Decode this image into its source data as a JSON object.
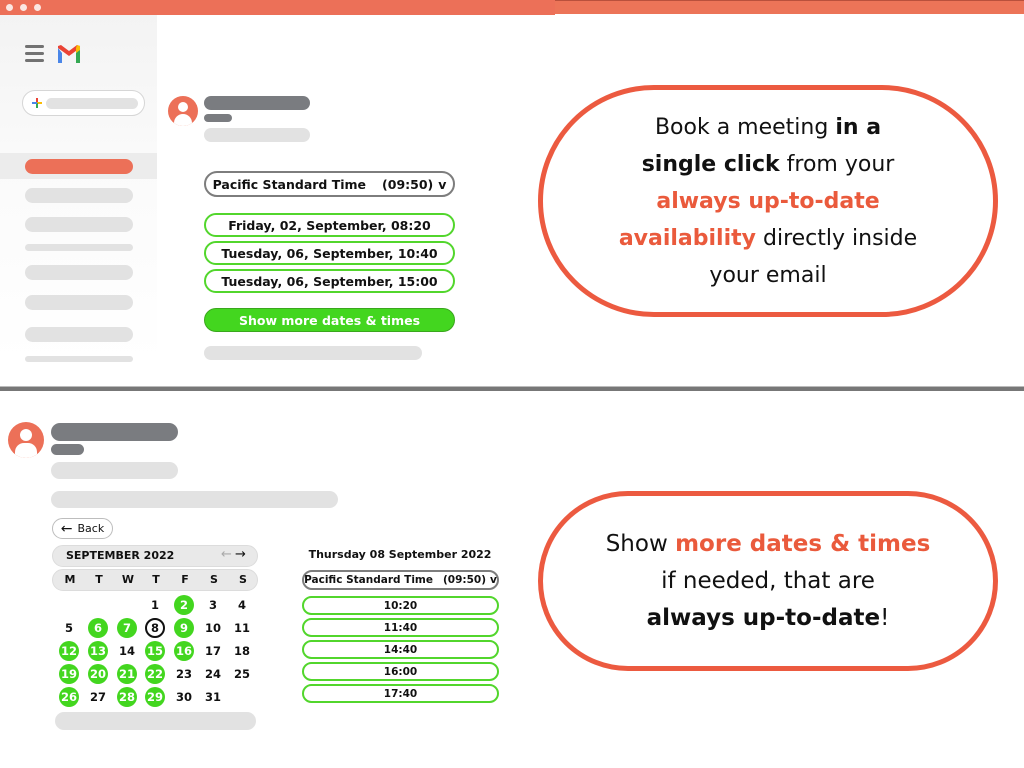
{
  "window": {
    "controls": [
      "close-dot",
      "minimize-dot",
      "maximize-dot"
    ],
    "accent_color": "#ec7058"
  },
  "gmail": {
    "menu_icon": "hamburger-icon",
    "logo_icon": "gmail-logo-icon",
    "compose_icon": "plus-icon"
  },
  "top_panel": {
    "timezone_select": {
      "label": "Pacific Standard Time",
      "current_time": "(09:50)",
      "chevron": "v"
    },
    "suggested_slots": [
      "Friday, 02, September, 08:20",
      "Tuesday, 06, September, 10:40",
      "Tuesday, 06, September, 15:00"
    ],
    "show_more_label": "Show more dates & times",
    "callout": {
      "line1_plain": "Book a meeting ",
      "line1_bold": "in a",
      "line2_bold": "single click",
      "line2_plain": " from your",
      "line3_accent": "always up-to-date",
      "line4_accent": "availability",
      "line4_plain": " directly inside",
      "line5_plain": "your email"
    }
  },
  "bottom_panel": {
    "back_label": "Back",
    "calendar": {
      "month_label": "SEPTEMBER 2022",
      "prev_icon": "←",
      "next_icon": "→",
      "weekdays": [
        "M",
        "T",
        "W",
        "T",
        "F",
        "S",
        "S"
      ],
      "first_weekday_index": 3,
      "days_in_month": 31,
      "available_days": [
        2,
        6,
        7,
        9,
        12,
        13,
        15,
        16,
        19,
        20,
        21,
        22,
        26,
        28,
        29
      ],
      "selected_day": 8
    },
    "selected_date_label": "Thursday 08 September 2022",
    "timezone_select": {
      "label": "Pacific Standard Time",
      "current_time": "(09:50)",
      "chevron": "v"
    },
    "time_slots": [
      "10:20",
      "11:40",
      "14:40",
      "16:00",
      "17:40"
    ],
    "callout": {
      "line1_plain": "Show ",
      "line1_accent": "more dates & times",
      "line2_plain": "if needed, that are",
      "line3_bold": "always up-to-date",
      "line3_plain": "!"
    }
  },
  "colors": {
    "accent_orange": "#ea5a3c",
    "available_green": "#43d61f",
    "slot_border_green": "#52d62c",
    "placeholder_dark": "#7a7c80",
    "placeholder_light": "#e2e2e2"
  }
}
